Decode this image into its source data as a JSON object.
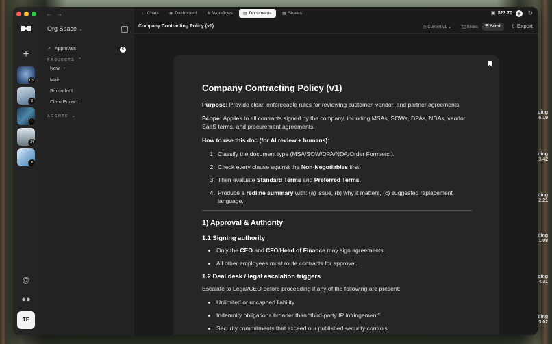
{
  "desktop": {
    "side_labels": [
      {
        "t1": "ding",
        "t2": "6.19"
      },
      {
        "t1": "ding",
        "t2": "3.42"
      },
      {
        "t1": "ding",
        "t2": "2.21"
      },
      {
        "t1": "ding",
        "t2": "1.08"
      },
      {
        "t1": "ding",
        "t2": "4.31"
      },
      {
        "t1": "ding",
        "t2": "3.02"
      }
    ]
  },
  "rail": {
    "workspaces": [
      {
        "badge": "OS"
      },
      {
        "badge": "8"
      },
      {
        "badge": "1"
      },
      {
        "badge": "14"
      },
      {
        "badge": "0"
      }
    ],
    "user_initials": "TE"
  },
  "sidebar": {
    "org_name": "Org Space",
    "approvals_label": "Approvals",
    "approvals_count": "6",
    "projects_header": "PROJECTS",
    "projects_new": "New",
    "projects": [
      "Main",
      "Rinisodent",
      "Clero Project"
    ],
    "agents_header": "AGENTS"
  },
  "tabs": [
    {
      "label": "Chats",
      "icon": "chat-icon"
    },
    {
      "label": "Dashboard",
      "icon": "dashboard-icon"
    },
    {
      "label": "Workflows",
      "icon": "workflow-icon"
    },
    {
      "label": "Documents",
      "icon": "document-icon",
      "active": true
    },
    {
      "label": "Sheets",
      "icon": "sheet-icon"
    }
  ],
  "balance": "$23.70",
  "docbar": {
    "title": "Company Contracting Policy (v1)",
    "version": "Current v1",
    "slides": "Slides",
    "scroll": "Scroll",
    "export": "Export"
  },
  "doc": {
    "heading": "Company Contracting Policy (v1)",
    "purpose_label": "Purpose:",
    "purpose_text": " Provide clear, enforceable rules for reviewing customer, vendor, and partner agreements.",
    "scope_label": "Scope:",
    "scope_text": " Applies to all contracts signed by the company, including MSAs, SOWs, DPAs, NDAs, vendor SaaS terms, and procurement agreements.",
    "howto": "How to use this doc (for AI review + humans):",
    "step1": "Classify the document type (MSA/SOW/DPA/NDA/Order Form/etc.).",
    "step2_a": "Check every clause against the ",
    "step2_b": "Non-Negotiables",
    "step2_c": " first.",
    "step3_a": "Then evaluate ",
    "step3_b": "Standard Terms",
    "step3_c": " and ",
    "step3_d": "Preferred Terms",
    "step3_e": ".",
    "step4_a": "Produce a ",
    "step4_b": "redline summary",
    "step4_c": " with: (a) issue, (b) why it matters, (c) suggested replacement language.",
    "section1": "1) Approval & Authority",
    "sub11": "1.1 Signing authority",
    "b11_a": "Only the ",
    "b11_b": "CEO",
    "b11_c": " and ",
    "b11_d": "CFO/Head of Finance",
    "b11_e": " may sign agreements.",
    "b11_2": "All other employees must route contracts for approval.",
    "sub12": "1.2 Deal desk / legal escalation triggers",
    "escalate": "Escalate to Legal/CEO before proceeding if any of the following are present:",
    "e1": "Unlimited or uncapped liability",
    "e2": "Indemnity obligations broader than “third-party IP infringement”",
    "e3": "Security commitments that exceed our published security controls"
  }
}
